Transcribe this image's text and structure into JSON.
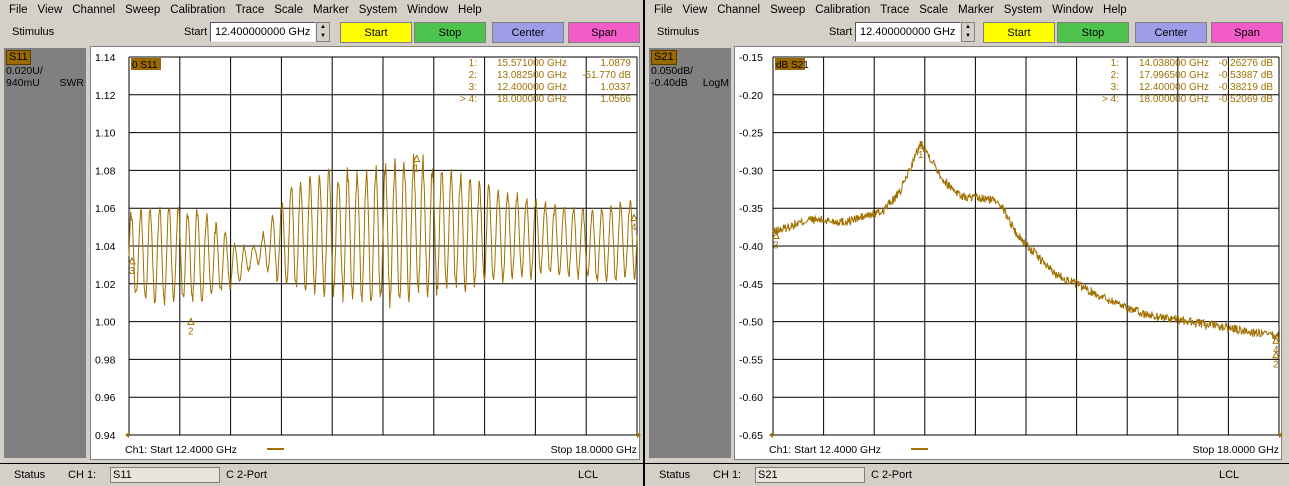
{
  "menu": [
    "File",
    "View",
    "Channel",
    "Sweep",
    "Calibration",
    "Trace",
    "Scale",
    "Marker",
    "System",
    "Window",
    "Help"
  ],
  "toolbar": {
    "stimulus_label": "Stimulus",
    "start_label": "Start",
    "start_value": "12.400000000 GHz",
    "buttons": [
      {
        "label": "Start",
        "color": "#ffff00"
      },
      {
        "label": "Stop",
        "color": "#4ec44e"
      },
      {
        "label": "Center",
        "color": "#9e9ee8"
      },
      {
        "label": "Span",
        "color": "#f25cc8"
      }
    ]
  },
  "colors": {
    "trace": "#a07000",
    "grid": "#000000",
    "background": "#ffffff"
  },
  "left": {
    "trace_label": "S11",
    "scale_line1": "0.020U/",
    "scale_line2": "940mU",
    "format": "SWR",
    "plot_tag": "0 S11",
    "markers": [
      {
        "id": "1:",
        "freq": "15.571000 GHz",
        "value": "1.0879"
      },
      {
        "id": "2:",
        "freq": "13.082500 GHz",
        "value": "-51.770 dB"
      },
      {
        "id": "3:",
        "freq": "12.400000 GHz",
        "value": "1.0337"
      },
      {
        "id": "> 4:",
        "freq": "18.000000 GHz",
        "value": "1.0566"
      }
    ],
    "footer_start": "Ch1: Start  12.4000 GHz",
    "footer_stop": "Stop  18.0000 GHz",
    "status": {
      "status": "Status",
      "channel": "CH 1:",
      "param": "S11",
      "cal": "C  2-Port",
      "mode": "LCL"
    }
  },
  "right": {
    "trace_label": "S21",
    "scale_line1": "0.050dB/",
    "scale_line2": "-0.40dB",
    "format": "LogM",
    "plot_tag": "dB S21",
    "markers": [
      {
        "id": "1:",
        "freq": "14.038000 GHz",
        "value": "-0.26276 dB"
      },
      {
        "id": "2:",
        "freq": "17.996500 GHz",
        "value": "-0.53987 dB"
      },
      {
        "id": "3:",
        "freq": "12.400000 GHz",
        "value": "-0.38219 dB"
      },
      {
        "id": "> 4:",
        "freq": "18.000000 GHz",
        "value": "-0.52069 dB"
      }
    ],
    "footer_start": "Ch1: Start  12.4000 GHz",
    "footer_stop": "Stop  18.0000 GHz",
    "status": {
      "status": "Status",
      "channel": "CH 1:",
      "param": "S21",
      "cal": "C  2-Port",
      "mode": "LCL"
    }
  },
  "chart_data": [
    {
      "type": "line",
      "trace": "S11",
      "format": "SWR",
      "xlim": [
        12.4,
        18.0
      ],
      "xunit": "GHz",
      "ylim": [
        0.94,
        1.14
      ],
      "yticks": [
        "1.14",
        "1.12",
        "1.10",
        "1.08",
        "1.06",
        "1.04",
        "1.02",
        "1.00",
        "0.98",
        "0.96",
        "0.94"
      ],
      "grid": true,
      "envelope": {
        "x": [
          12.4,
          12.8,
          13.2,
          13.6,
          13.8,
          14.2,
          14.6,
          15.0,
          15.4,
          15.6,
          16.0,
          16.4,
          16.8,
          17.2,
          17.6,
          18.0
        ],
        "center": [
          1.035,
          1.036,
          1.035,
          1.03,
          1.036,
          1.045,
          1.047,
          1.045,
          1.048,
          1.05,
          1.048,
          1.046,
          1.045,
          1.043,
          1.04,
          1.045
        ],
        "amplitude": [
          0.022,
          0.025,
          0.023,
          0.01,
          0.004,
          0.028,
          0.03,
          0.034,
          0.036,
          0.034,
          0.03,
          0.024,
          0.02,
          0.017,
          0.018,
          0.02
        ]
      },
      "ripple_cycles": 54,
      "markers": [
        {
          "label": "1",
          "x": 15.571,
          "y": 1.0879
        },
        {
          "label": "2",
          "x": 13.0825,
          "y": 1.0017
        },
        {
          "label": "3",
          "x": 12.4,
          "y": 1.0337
        },
        {
          "label": "4",
          "x": 18.0,
          "y": 1.0566
        }
      ]
    },
    {
      "type": "line",
      "trace": "S21",
      "format": "LogM",
      "xlim": [
        12.4,
        18.0
      ],
      "xunit": "GHz",
      "ylim": [
        -0.65,
        -0.15
      ],
      "yticks": [
        "-0.15",
        "-0.20",
        "-0.25",
        "-0.30",
        "-0.35",
        "-0.40",
        "-0.45",
        "-0.50",
        "-0.55",
        "-0.60",
        "-0.65"
      ],
      "grid": true,
      "x": [
        12.4,
        12.8,
        13.2,
        13.6,
        13.8,
        14.04,
        14.3,
        14.5,
        14.9,
        15.1,
        15.5,
        16.0,
        16.5,
        17.0,
        17.5,
        18.0
      ],
      "y": [
        -0.382,
        -0.365,
        -0.368,
        -0.355,
        -0.33,
        -0.263,
        -0.315,
        -0.335,
        -0.34,
        -0.385,
        -0.435,
        -0.465,
        -0.49,
        -0.5,
        -0.51,
        -0.52
      ],
      "noise": 0.006,
      "markers": [
        {
          "label": "1",
          "x": 14.038,
          "y": -0.26276
        },
        {
          "label": "2",
          "x": 17.9965,
          "y": -0.53987
        },
        {
          "label": "3",
          "x": 12.4,
          "y": -0.38219
        },
        {
          "label": "4",
          "x": 18.0,
          "y": -0.52069
        }
      ]
    }
  ]
}
